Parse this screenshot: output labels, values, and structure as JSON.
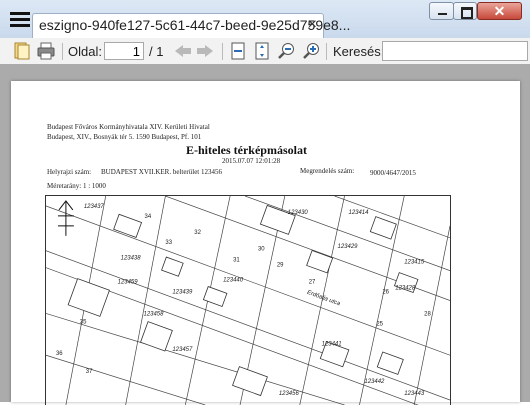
{
  "window": {
    "tab_title": "eszigno-940fe127-5c61-44c7-beed-9e25d759e8...",
    "tab_close": "×",
    "close_glyph": "✕"
  },
  "toolbar": {
    "page_label": "Oldal:",
    "page_value": "1",
    "page_total": "/ 1",
    "search_label": "Keresés:",
    "search_value": ""
  },
  "document": {
    "office_line1": "Budapest Főváros Kormányhivatala XIV. Kerületi Hivatal",
    "office_line2": "Budapest, XIV., Bosnyák tér 5. 1590 Budapest, Pf. 101",
    "title": "E-hiteles térképmásolat",
    "date": "2015.07.07 12:01:28",
    "parcel_label": "Helyrajzi szám:",
    "parcel_value": "BUDAPEST XVII.KER. belterület 123456",
    "order_label": "Megrendelés szám:",
    "order_value": "9000/4647/2015",
    "scale": "Méretarány:  1 : 1000"
  },
  "map": {
    "parcel_labels": [
      "123437",
      "123438",
      "123439",
      "123440",
      "123430",
      "123414",
      "123429",
      "123415",
      "123428",
      "123459",
      "123458",
      "123457",
      "123441",
      "123442",
      "123456",
      "123443"
    ],
    "street_numbers": [
      "34",
      "32",
      "30",
      "29",
      "27",
      "26",
      "25",
      "28",
      "31",
      "33",
      "35",
      "36",
      "37"
    ],
    "street_name": "Erdőalja utca"
  }
}
